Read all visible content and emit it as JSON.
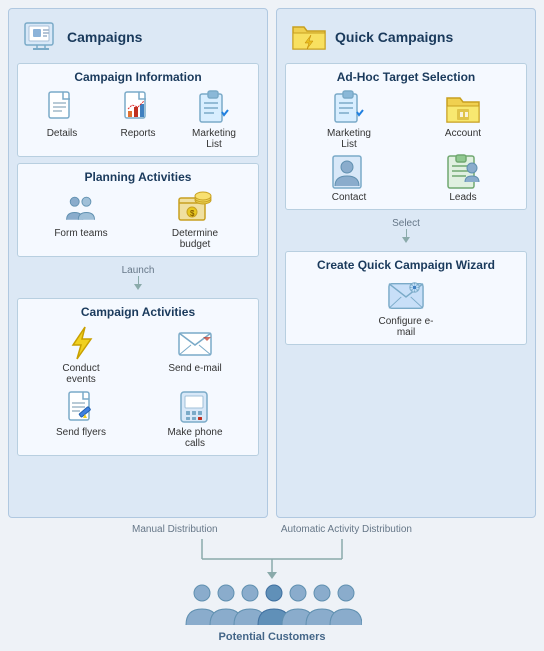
{
  "leftPanel": {
    "title": "Campaigns",
    "campaignInfo": {
      "title": "Campaign Information",
      "items": [
        {
          "label": "Details",
          "icon": "document-icon"
        },
        {
          "label": "Reports",
          "icon": "report-icon"
        },
        {
          "label": "Marketing List",
          "icon": "marketing-list-icon"
        }
      ]
    },
    "planningActivities": {
      "title": "Planning Activities",
      "items": [
        {
          "label": "Form teams",
          "icon": "people-icon"
        },
        {
          "label": "Determine budget",
          "icon": "budget-icon"
        }
      ],
      "arrow_label": "Launch"
    },
    "campaignActivities": {
      "title": "Campaign Activities",
      "items": [
        {
          "label": "Conduct events",
          "icon": "lightning-icon"
        },
        {
          "label": "Send e-mail",
          "icon": "email-icon"
        },
        {
          "label": "Send flyers",
          "icon": "flyer-icon"
        },
        {
          "label": "Make phone calls",
          "icon": "phone-icon"
        }
      ]
    }
  },
  "rightPanel": {
    "title": "Quick Campaigns",
    "adHoc": {
      "title": "Ad-Hoc Target Selection",
      "items": [
        {
          "label": "Marketing List",
          "icon": "marketing-list-icon"
        },
        {
          "label": "Account",
          "icon": "account-icon"
        },
        {
          "label": "Contact",
          "icon": "contact-icon"
        },
        {
          "label": "Leads",
          "icon": "leads-icon"
        }
      ],
      "arrow_label": "Select"
    },
    "wizard": {
      "title": "Create Quick Campaign Wizard",
      "items": [
        {
          "label": "Configure e-mail",
          "icon": "config-email-icon"
        }
      ]
    }
  },
  "bottom": {
    "leftLabel": "Manual Distribution",
    "rightLabel": "Automatic Activity Distribution",
    "customersLabel": "Potential Customers"
  }
}
